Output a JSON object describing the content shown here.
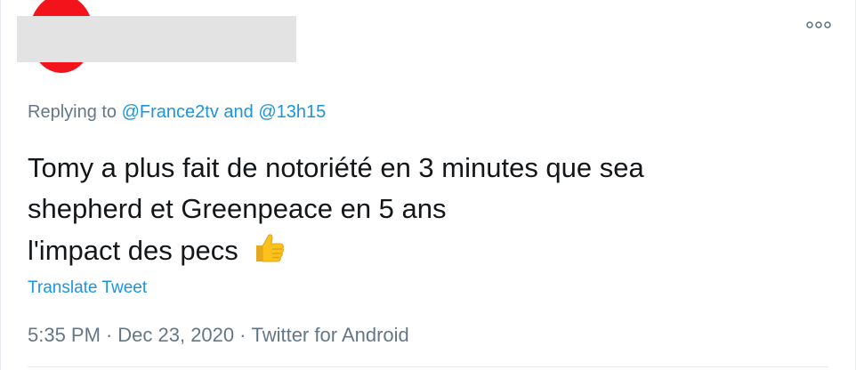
{
  "tweet": {
    "avatar_color": "#f3131a",
    "reply": {
      "prefix": "Replying to",
      "mention1": "@France2tv",
      "joiner": "and",
      "mention2": "@13h15"
    },
    "text_lines": [
      "Tomy a plus fait de notoriété en 3 minutes que sea",
      "shepherd et Greenpeace en 5 ans",
      "l'impact des pecs"
    ],
    "emoji_icon": "thumbs-up-icon",
    "translate_label": "Translate Tweet",
    "time": "5:35 PM",
    "date": "Dec 23, 2020",
    "source": "Twitter for Android",
    "separator": "·",
    "more_icon": "more-options-icon"
  },
  "colors": {
    "link": "#1b95e0",
    "muted": "#657786",
    "text": "#14171a"
  }
}
